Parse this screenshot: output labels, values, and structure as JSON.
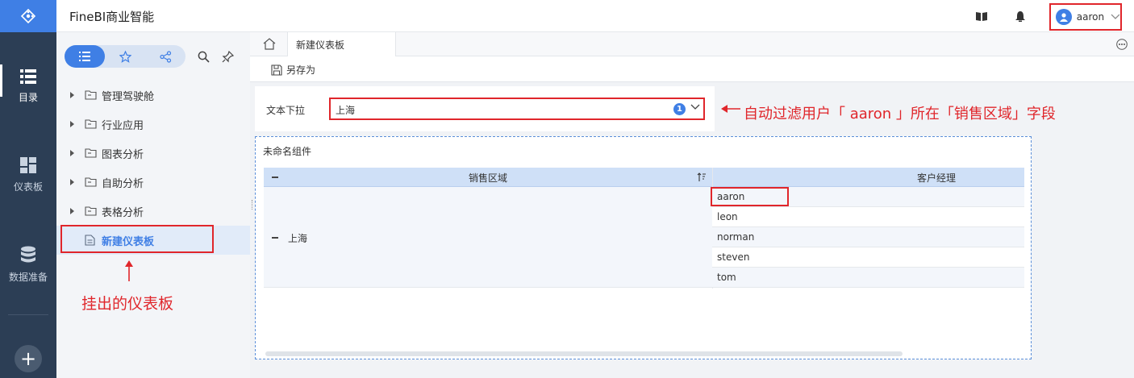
{
  "app": {
    "title": "FineBI商业智能"
  },
  "nav": {
    "items": [
      {
        "label": "目录",
        "icon": "list-icon",
        "active": true
      },
      {
        "label": "仪表板",
        "icon": "dashboard-icon",
        "active": false
      },
      {
        "label": "数据准备",
        "icon": "database-icon",
        "active": false
      }
    ],
    "add_label": "+"
  },
  "header": {
    "user": "aaron"
  },
  "directory": {
    "items": [
      {
        "label": "管理驾驶舱"
      },
      {
        "label": "行业应用"
      },
      {
        "label": "图表分析"
      },
      {
        "label": "自助分析"
      },
      {
        "label": "表格分析"
      }
    ],
    "selected": {
      "label": "新建仪表板"
    }
  },
  "tabs": {
    "active": "新建仪表板"
  },
  "toolbar": {
    "save_as": "另存为"
  },
  "filter": {
    "label": "文本下拉",
    "value": "上海",
    "count": "1"
  },
  "widget": {
    "title": "未命名组件",
    "columns": [
      "销售区域",
      "客户经理"
    ],
    "region": "上海",
    "managers": [
      "aaron",
      "leon",
      "norman",
      "steven",
      "tom"
    ]
  },
  "annotations": {
    "left": "挂出的仪表板",
    "right": "自动过滤用户「 aaron 」所在「销售区域」字段"
  },
  "colors": {
    "accent": "#3f7fe5",
    "nav_bg": "#2c3e55",
    "annotation": "#e0262b"
  }
}
